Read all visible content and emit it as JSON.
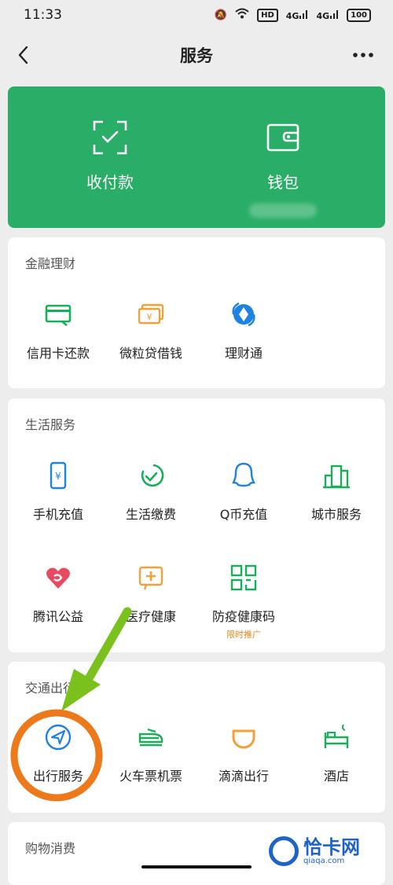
{
  "status": {
    "time": "11:33",
    "hd": "HD",
    "net1": "4G",
    "net2": "4G",
    "battery": "100"
  },
  "nav": {
    "title": "服务"
  },
  "hero": {
    "pay_label": "收付款",
    "wallet_label": "钱包"
  },
  "finance": {
    "title": "金融理财",
    "items": [
      {
        "label": "信用卡还款",
        "icon": "credit-card-icon"
      },
      {
        "label": "微粒贷借钱",
        "icon": "loan-icon"
      },
      {
        "label": "理财通",
        "icon": "wealth-icon"
      }
    ]
  },
  "life": {
    "title": "生活服务",
    "items": [
      {
        "label": "手机充值",
        "icon": "phone-topup-icon"
      },
      {
        "label": "生活缴费",
        "icon": "utility-icon"
      },
      {
        "label": "Q币充值",
        "icon": "qcoin-icon"
      },
      {
        "label": "城市服务",
        "icon": "city-icon"
      },
      {
        "label": "腾讯公益",
        "icon": "charity-icon"
      },
      {
        "label": "医疗健康",
        "icon": "medical-icon"
      },
      {
        "label": "防疫健康码",
        "icon": "qr-code-icon",
        "tag": "限时推广"
      }
    ]
  },
  "transport": {
    "title": "交通出行",
    "items": [
      {
        "label": "出行服务",
        "icon": "navigation-icon"
      },
      {
        "label": "火车票机票",
        "icon": "train-icon"
      },
      {
        "label": "滴滴出行",
        "icon": "didi-icon"
      },
      {
        "label": "酒店",
        "icon": "hotel-icon"
      }
    ]
  },
  "shopping": {
    "title": "购物消费"
  },
  "watermark": {
    "text": "恰卡网",
    "sub": "qiaqa.com"
  },
  "colors": {
    "green": "#2aae67",
    "icon_green": "#1aad5a",
    "icon_blue": "#1e82e0",
    "icon_orange": "#f0a03c",
    "arrow": "#7bc11e",
    "circle": "#ec7a1c"
  }
}
